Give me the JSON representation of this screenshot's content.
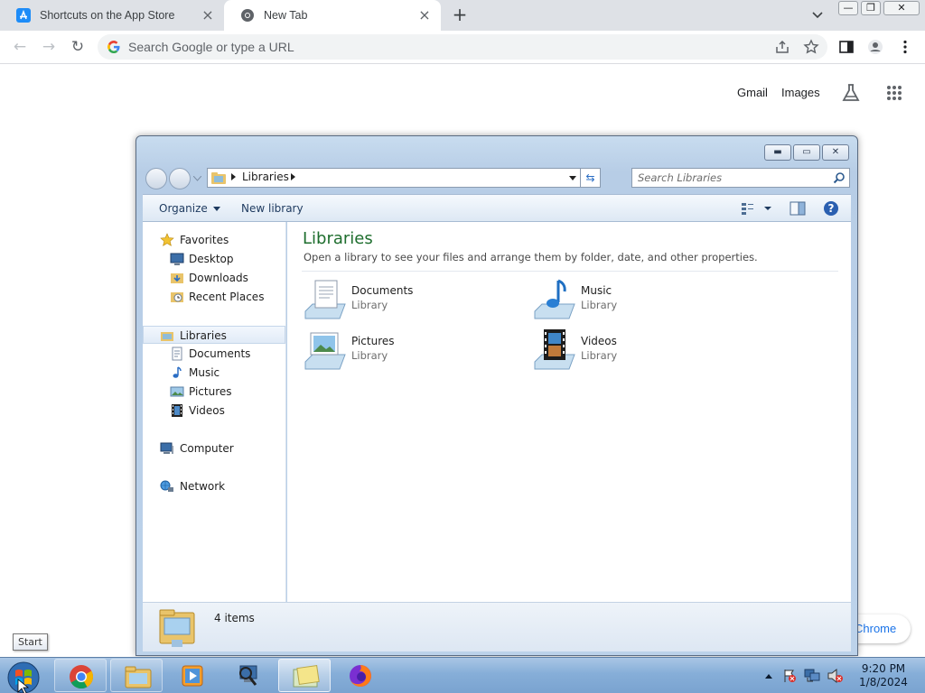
{
  "chrome": {
    "tabs": [
      {
        "label": "Shortcuts on the App Store",
        "icon": "app-store-icon"
      },
      {
        "label": "New Tab",
        "icon": "chrome-icon",
        "active": true
      }
    ],
    "omnibox_placeholder": "Search Google or type a URL",
    "ntp": {
      "gmail_label": "Gmail",
      "images_label": "Images",
      "customize_label": "Chrome"
    }
  },
  "explorer": {
    "breadcrumb": [
      "Libraries"
    ],
    "search_placeholder": "Search Libraries",
    "commands": {
      "organize": "Organize",
      "new_library": "New library"
    },
    "nav": {
      "favorites": {
        "label": "Favorites",
        "items": [
          "Desktop",
          "Downloads",
          "Recent Places"
        ]
      },
      "libraries": {
        "label": "Libraries",
        "items": [
          "Documents",
          "Music",
          "Pictures",
          "Videos"
        ]
      },
      "computer": "Computer",
      "network": "Network"
    },
    "content": {
      "title": "Libraries",
      "description": "Open a library to see your files and arrange them by folder, date, and other properties.",
      "libraries": [
        {
          "name": "Documents",
          "type": "Library",
          "icon": "documents-library-icon"
        },
        {
          "name": "Music",
          "type": "Library",
          "icon": "music-library-icon"
        },
        {
          "name": "Pictures",
          "type": "Library",
          "icon": "pictures-library-icon"
        },
        {
          "name": "Videos",
          "type": "Library",
          "icon": "videos-library-icon"
        }
      ]
    },
    "details": {
      "count": "4 items"
    }
  },
  "taskbar": {
    "tooltip": "Start",
    "clock": {
      "time": "9:20 PM",
      "date": "1/8/2024"
    },
    "apps": [
      "chrome",
      "windows-explorer",
      "media-player",
      "network-tool",
      "libraries-window",
      "firefox"
    ]
  },
  "colors": {
    "library_title": "#1e6e2e",
    "taskbar": "#86aed8",
    "chrome_tabbar": "#dee1e6"
  }
}
